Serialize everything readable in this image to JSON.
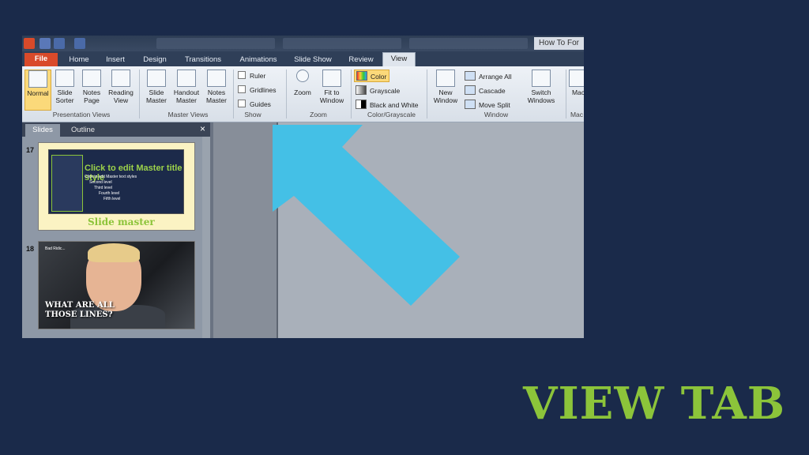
{
  "window": {
    "title": "How To For"
  },
  "tabs": [
    "File",
    "Home",
    "Insert",
    "Design",
    "Transitions",
    "Animations",
    "Slide Show",
    "Review",
    "View"
  ],
  "ribbon": {
    "presentation_views": {
      "label": "Presentation Views",
      "buttons": [
        {
          "l1": "Normal",
          "l2": ""
        },
        {
          "l1": "Slide",
          "l2": "Sorter"
        },
        {
          "l1": "Notes",
          "l2": "Page"
        },
        {
          "l1": "Reading",
          "l2": "View"
        }
      ]
    },
    "master_views": {
      "label": "Master Views",
      "buttons": [
        {
          "l1": "Slide",
          "l2": "Master"
        },
        {
          "l1": "Handout",
          "l2": "Master"
        },
        {
          "l1": "Notes",
          "l2": "Master"
        }
      ]
    },
    "show": {
      "label": "Show",
      "items": [
        "Ruler",
        "Gridlines",
        "Guides"
      ]
    },
    "zoom": {
      "label": "Zoom",
      "zoom": "Zoom",
      "fit1": "Fit to",
      "fit2": "Window"
    },
    "color": {
      "label": "Color/Grayscale",
      "items": [
        "Color",
        "Grayscale",
        "Black and White"
      ]
    },
    "window": {
      "label": "Window",
      "new1": "New",
      "new2": "Window",
      "items": [
        "Arrange All",
        "Cascade",
        "Move Split"
      ],
      "switch1": "Switch",
      "switch2": "Windows"
    },
    "macros": {
      "label": "Mac",
      "btn": "Mac"
    }
  },
  "panel": {
    "tabs": [
      "Slides",
      "Outline"
    ],
    "close": "×",
    "slides": [
      {
        "num": "17",
        "title": "Click to edit Master title style",
        "body": [
          "Click to edit Master text styles",
          "Second level",
          "Third level",
          "Fourth level",
          "Fifth level"
        ],
        "footer": "Slide master"
      },
      {
        "num": "18",
        "small": "Bad Ridic...",
        "caption1": "WHAT ARE ALL",
        "caption2": "THOSE LINES?"
      }
    ]
  },
  "heading": "VIEW TAB",
  "colors": {
    "background": "#1a2a4a",
    "arrow": "#44c0e6",
    "accent": "#8cc43a",
    "file_tab": "#d94a2a"
  }
}
